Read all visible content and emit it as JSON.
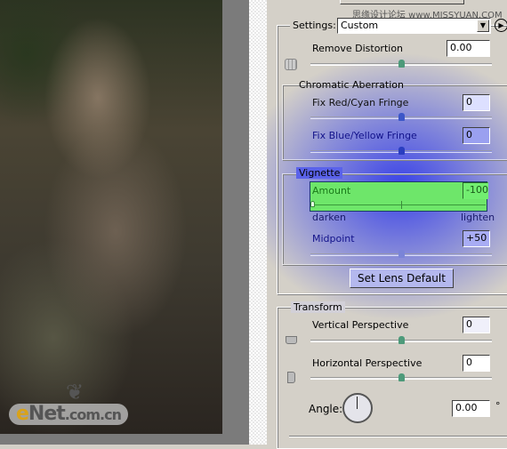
{
  "watermark_top": "思缘设计论坛 www.MISSYUAN.COM",
  "watermark_bottom": "eNet.com.cn",
  "settings": {
    "label": "Settings:",
    "value": "Custom"
  },
  "remove_distortion": {
    "label": "Remove Distortion",
    "value": "0.00",
    "slider": 0.5
  },
  "chromatic": {
    "title": "Chromatic Aberration",
    "red_cyan": {
      "label": "Fix Red/Cyan Fringe",
      "value": "0",
      "slider": 0.5
    },
    "blue_yellow": {
      "label": "Fix Blue/Yellow Fringe",
      "value": "0",
      "slider": 0.5
    }
  },
  "vignette": {
    "title": "Vignette",
    "amount": {
      "label": "Amount",
      "value": "-100",
      "slider": 0.0,
      "min_label": "darken",
      "max_label": "lighten"
    },
    "midpoint": {
      "label": "Midpoint",
      "value": "+50",
      "slider": 0.5
    }
  },
  "set_lens_default": "Set Lens Default",
  "transform": {
    "title": "Transform",
    "vertical": {
      "label": "Vertical Perspective",
      "value": "0",
      "slider": 0.5
    },
    "horizontal": {
      "label": "Horizontal Perspective",
      "value": "0",
      "slider": 0.5
    },
    "angle": {
      "label": "Angle:",
      "value": "0.00",
      "unit": "°"
    }
  },
  "colors": {
    "highlight": "#6ee66a",
    "glow": "#2832eb"
  }
}
